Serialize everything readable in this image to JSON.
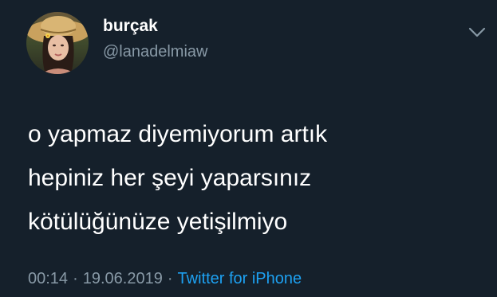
{
  "author": {
    "display_name": "burçak",
    "handle": "@lanadelmiaw"
  },
  "tweet": {
    "lines": [
      "o yapmaz diyemiyorum artık",
      "hepiniz her şeyi yaparsınız",
      "kötülüğünüze yetişilmiyo"
    ]
  },
  "meta": {
    "time": "00:14",
    "separator": "·",
    "date": "19.06.2019",
    "source": "Twitter for iPhone"
  },
  "colors": {
    "background": "#15202b",
    "primary_text": "#ffffff",
    "secondary_text": "#8899a6",
    "link": "#1da1f2"
  },
  "icons": {
    "menu": "chevron-down-icon",
    "avatar": "profile-photo"
  }
}
